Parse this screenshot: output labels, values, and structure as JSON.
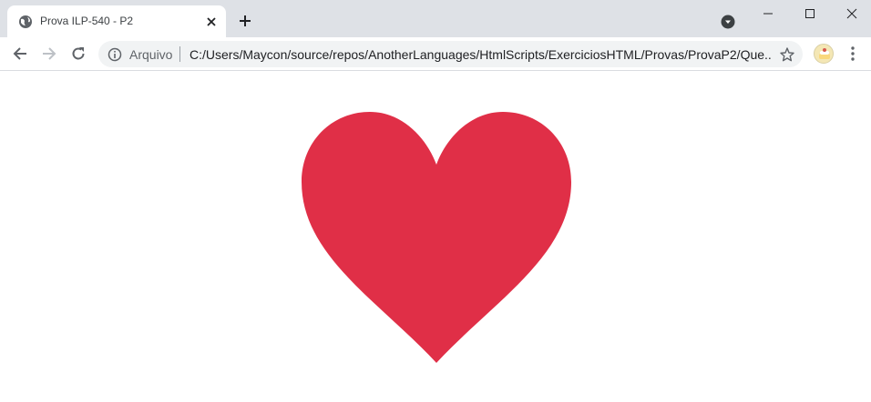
{
  "browser": {
    "tab": {
      "title": "Prova ILP-540 - P2"
    },
    "omnibox": {
      "scheme_label": "Arquivo",
      "url": "C:/Users/Maycon/source/repos/AnotherLanguages/HtmlScripts/ExerciciosHTML/Provas/ProvaP2/Que..."
    },
    "icons": {
      "favicon": "globe-icon",
      "tab_close": "close-icon",
      "new_tab": "plus-icon",
      "back": "arrow-left-icon",
      "forward": "arrow-right-icon",
      "reload": "reload-icon",
      "info": "info-icon",
      "bookmark": "star-icon",
      "menu": "kebab-menu-icon"
    }
  },
  "page": {
    "heart": {
      "shape": "heart-icon",
      "color": "#e02f47"
    }
  }
}
